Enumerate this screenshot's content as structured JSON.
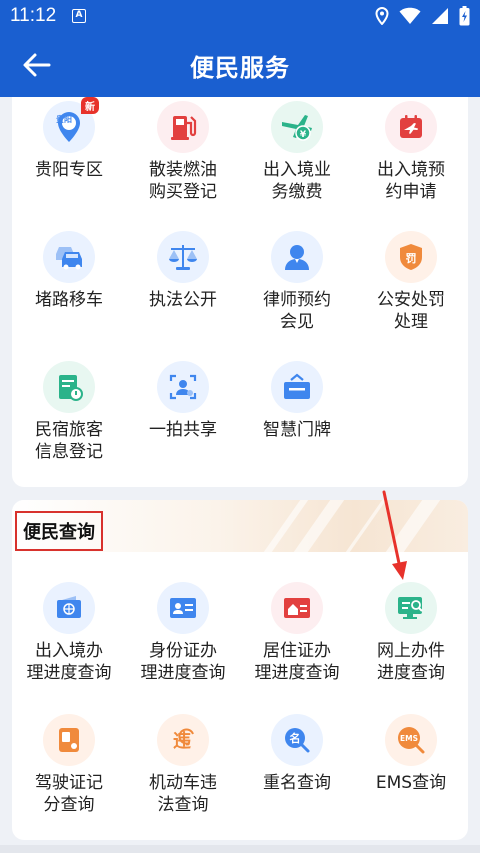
{
  "status": {
    "time": "11:12",
    "badge": "A"
  },
  "header": {
    "title": "便民服务"
  },
  "grid1": [
    {
      "label": "贵阳专区",
      "icon": "guiyang-icon",
      "badge": "新",
      "map_text": "贵阳"
    },
    {
      "label": "散装燃油\n购买登记",
      "icon": "fuel-icon"
    },
    {
      "label": "出入境业\n务缴费",
      "icon": "plane-payment-icon",
      "coin": "¥"
    },
    {
      "label": "出入境预\n约申请",
      "icon": "calendar-plane-icon"
    },
    {
      "label": "堵路移车",
      "icon": "car-move-icon"
    },
    {
      "label": "执法公开",
      "icon": "scales-icon"
    },
    {
      "label": "律师预约\n会见",
      "icon": "lawyer-icon"
    },
    {
      "label": "公安处罚\n处理",
      "icon": "penalty-icon",
      "stamp": "罚"
    },
    {
      "label": "民宿旅客\n信息登记",
      "icon": "register-form-icon"
    },
    {
      "label": "一拍共享",
      "icon": "face-scan-icon"
    },
    {
      "label": "智慧门牌",
      "icon": "door-plate-icon"
    }
  ],
  "query": {
    "title": "便民查询",
    "items": [
      {
        "label": "出入境办\n理进度查询",
        "icon": "passport-icon"
      },
      {
        "label": "身份证办\n理进度查询",
        "icon": "id-card-icon"
      },
      {
        "label": "居住证办\n理进度查询",
        "icon": "residence-card-icon"
      },
      {
        "label": "网上办件\n进度查询",
        "icon": "online-progress-icon"
      },
      {
        "label": "驾驶证记\n分查询",
        "icon": "license-points-icon"
      },
      {
        "label": "机动车违\n法查询",
        "icon": "vehicle-violation-icon",
        "glyph": "违"
      },
      {
        "label": "重名查询",
        "icon": "same-name-icon",
        "glyph": "名"
      },
      {
        "label": "EMS查询",
        "icon": "ems-icon",
        "glyph": "EMS"
      }
    ]
  }
}
